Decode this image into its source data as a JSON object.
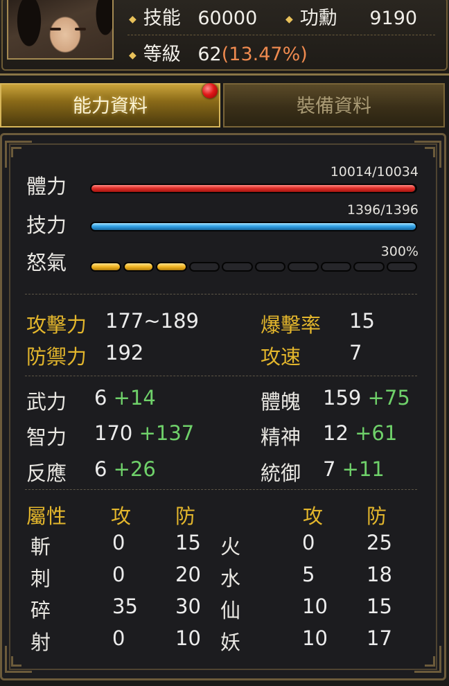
{
  "header": {
    "skill_label": "技能",
    "skill_value": "60000",
    "merit_label": "功勳",
    "merit_value": "9190",
    "level_label": "等級",
    "level_value": "62",
    "level_percent": "(13.47%)"
  },
  "tabs": [
    {
      "label": "能力資料",
      "active": true
    },
    {
      "label": "裝備資料",
      "active": false
    }
  ],
  "bars": {
    "hp": {
      "label": "體力",
      "value": "10014/10034",
      "fraction": 0.998
    },
    "mp": {
      "label": "技力",
      "value": "1396/1396",
      "fraction": 1.0
    },
    "rage": {
      "label": "怒氣",
      "value": "300%",
      "filled_segments": 3,
      "total_segments": 10
    }
  },
  "combat": {
    "atk_label": "攻擊力",
    "atk_value": "177~189",
    "crit_label": "爆擊率",
    "crit_value": "15",
    "def_label": "防禦力",
    "def_value": "192",
    "speed_label": "攻速",
    "speed_value": "7"
  },
  "attributes": [
    {
      "label": "武力",
      "base": "6",
      "bonus": "+14"
    },
    {
      "label": "智力",
      "base": "170",
      "bonus": "+137"
    },
    {
      "label": "反應",
      "base": "6",
      "bonus": "+26"
    },
    {
      "label": "體魄",
      "base": "159",
      "bonus": "+75"
    },
    {
      "label": "精神",
      "base": "12",
      "bonus": "+61"
    },
    {
      "label": "統御",
      "base": "7",
      "bonus": "+11"
    }
  ],
  "elements": {
    "header_attr": "屬性",
    "header_atk": "攻",
    "header_def": "防",
    "header_atk2": "攻",
    "header_def2": "防",
    "left": [
      {
        "name": "斬",
        "atk": "0",
        "def": "15"
      },
      {
        "name": "刺",
        "atk": "0",
        "def": "20"
      },
      {
        "name": "碎",
        "atk": "35",
        "def": "30"
      },
      {
        "name": "射",
        "atk": "0",
        "def": "10"
      }
    ],
    "right": [
      {
        "name": "火",
        "atk": "0",
        "def": "25"
      },
      {
        "name": "水",
        "atk": "5",
        "def": "18"
      },
      {
        "name": "仙",
        "atk": "10",
        "def": "15"
      },
      {
        "name": "妖",
        "atk": "10",
        "def": "17"
      }
    ]
  },
  "colors": {
    "gold": "#e3b62c",
    "bonus_green": "#6fd16a",
    "hp_red": "#e1312b",
    "mp_blue": "#33a3e6",
    "rage_yellow": "#f0b422",
    "level_orange": "#ef8a4f"
  }
}
